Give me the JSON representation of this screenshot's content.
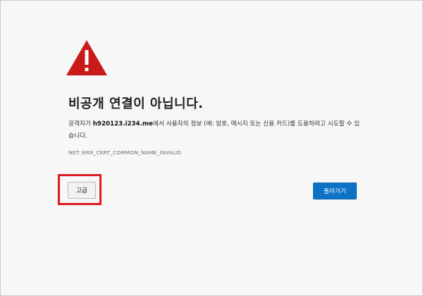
{
  "icons": {
    "warning": "warning-triangle-icon",
    "warning_color": "#c91a1a"
  },
  "error_page": {
    "title": "비공개 연결이 아닙니다.",
    "description_prefix": "공격자가 ",
    "host": "h920123.i234.me",
    "description_suffix": "에서 사용자의 정보 (예: 암호, 메시지 또는 신용 카드)를 도용하려고 시도할 수 있습니다.",
    "error_code": "NET::ERR_CERT_COMMON_NAME_INVALID"
  },
  "buttons": {
    "advanced_label": "고급",
    "back_label": "돌아가기",
    "back_color": "#0b72c6"
  },
  "annotation": {
    "highlight_color": "#e01b24"
  }
}
